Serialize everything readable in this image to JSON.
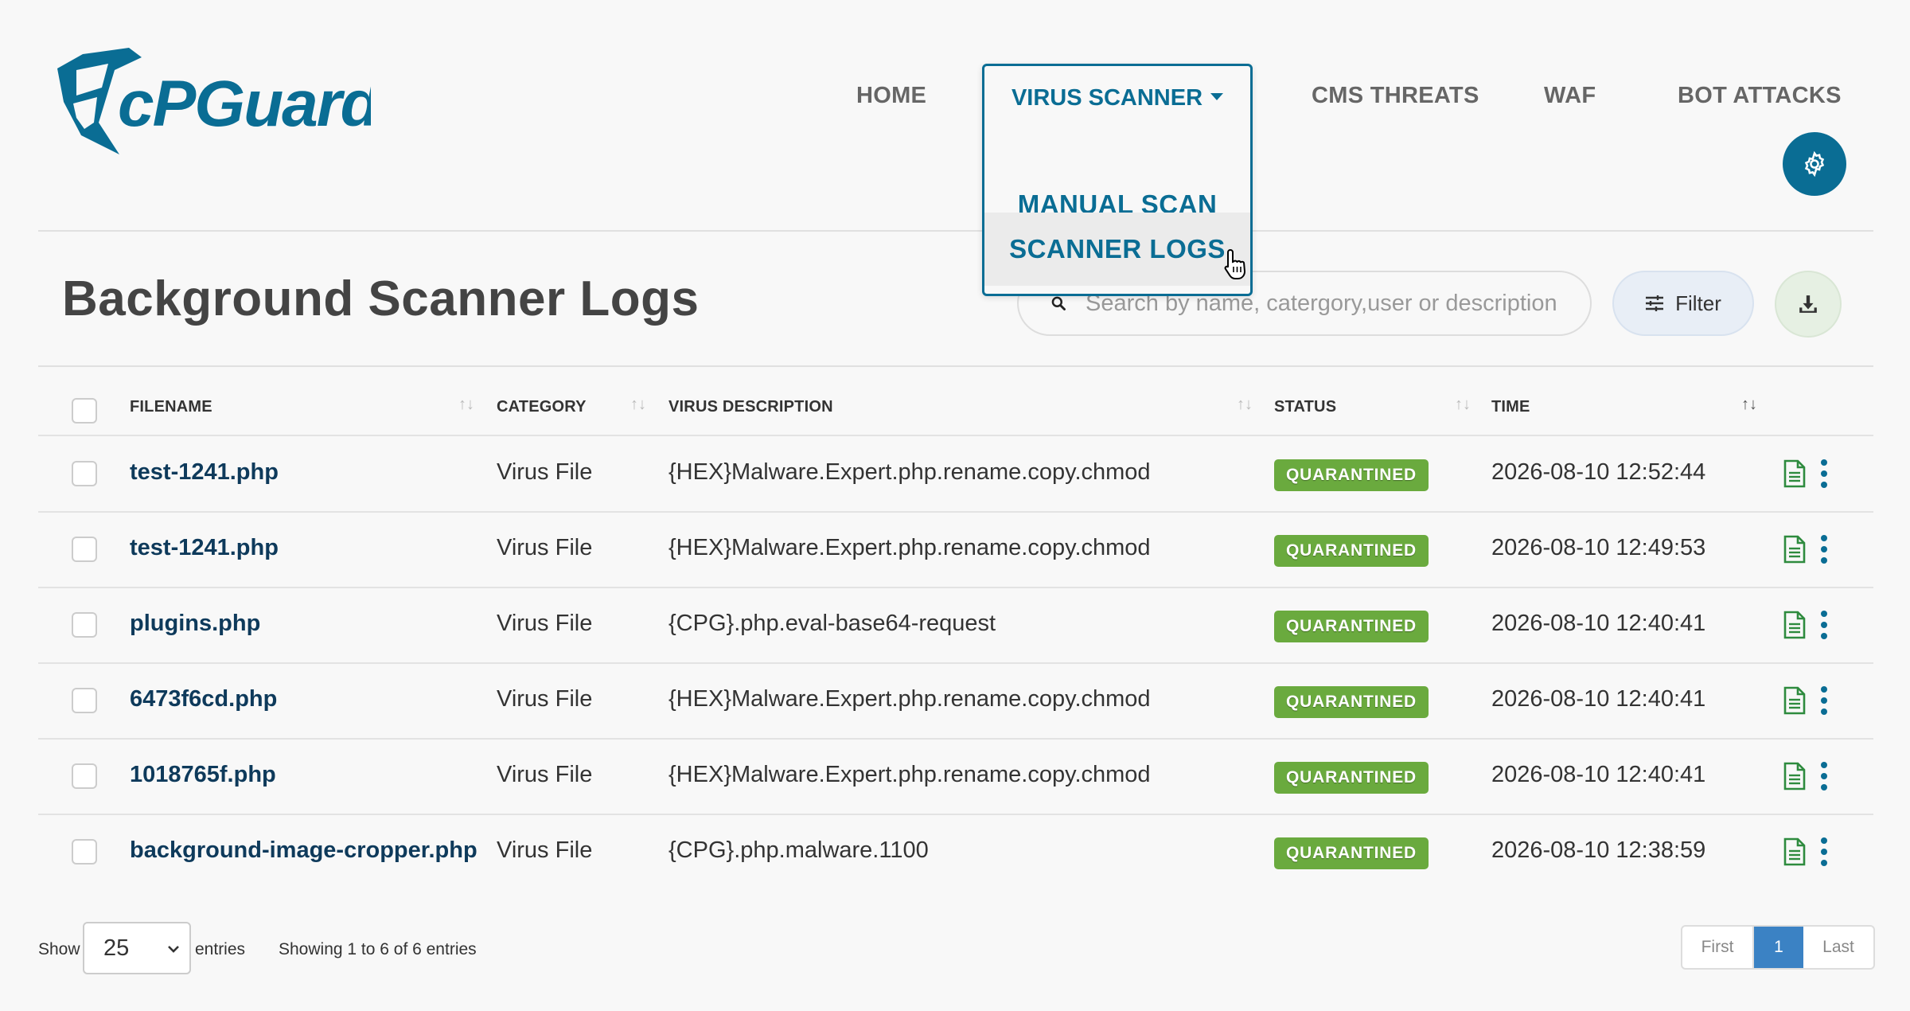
{
  "brand": {
    "logo_text": "cPGuard"
  },
  "nav": {
    "home": "HOME",
    "virus_scanner": "VIRUS SCANNER",
    "cms_threats": "CMS THREATS",
    "waf": "WAF",
    "bot_attacks": "BOT ATTACKS",
    "dropdown_items": [
      "MANUAL SCAN",
      "SCANNER LOGS"
    ]
  },
  "page": {
    "title": "Background Scanner Logs",
    "search_placeholder": "Search by name, catergory,user or description",
    "filter_label": "Filter"
  },
  "table": {
    "columns": [
      "FILENAME",
      "CATEGORY",
      "VIRUS DESCRIPTION",
      "STATUS",
      "TIME"
    ],
    "rows": [
      {
        "filename": "test-1241.php",
        "category": "Virus File",
        "description": "{HEX}Malware.Expert.php.rename.copy.chmod",
        "status": "QUARANTINED",
        "time": "2026-08-10 12:52:44"
      },
      {
        "filename": "test-1241.php",
        "category": "Virus File",
        "description": "{HEX}Malware.Expert.php.rename.copy.chmod",
        "status": "QUARANTINED",
        "time": "2026-08-10 12:49:53"
      },
      {
        "filename": "plugins.php",
        "category": "Virus File",
        "description": "{CPG}.php.eval-base64-request",
        "status": "QUARANTINED",
        "time": "2026-08-10 12:40:41"
      },
      {
        "filename": "6473f6cd.php",
        "category": "Virus File",
        "description": "{HEX}Malware.Expert.php.rename.copy.chmod",
        "status": "QUARANTINED",
        "time": "2026-08-10 12:40:41"
      },
      {
        "filename": "1018765f.php",
        "category": "Virus File",
        "description": "{HEX}Malware.Expert.php.rename.copy.chmod",
        "status": "QUARANTINED",
        "time": "2026-08-10 12:40:41"
      },
      {
        "filename": "background-image-cropper.php",
        "category": "Virus File",
        "description": "{CPG}.php.malware.1100",
        "status": "QUARANTINED",
        "time": "2026-08-10 12:38:59"
      }
    ]
  },
  "footer": {
    "show_label": "Show",
    "page_size": "25",
    "entries_label": "entries",
    "showing_text": "Showing 1 to 6 of 6 entries",
    "pager": {
      "first": "First",
      "current": "1",
      "last": "Last"
    }
  },
  "colors": {
    "accent": "#0a6d94",
    "quarantined": "#6aaa3e",
    "pager_active": "#3b82c4"
  },
  "icons": [
    "shield-logo-icon",
    "gear-icon",
    "search-icon",
    "sliders-icon",
    "download-icon",
    "sort-icon",
    "document-icon",
    "kebab-menu-icon",
    "chevron-down-icon",
    "hand-cursor-icon"
  ]
}
